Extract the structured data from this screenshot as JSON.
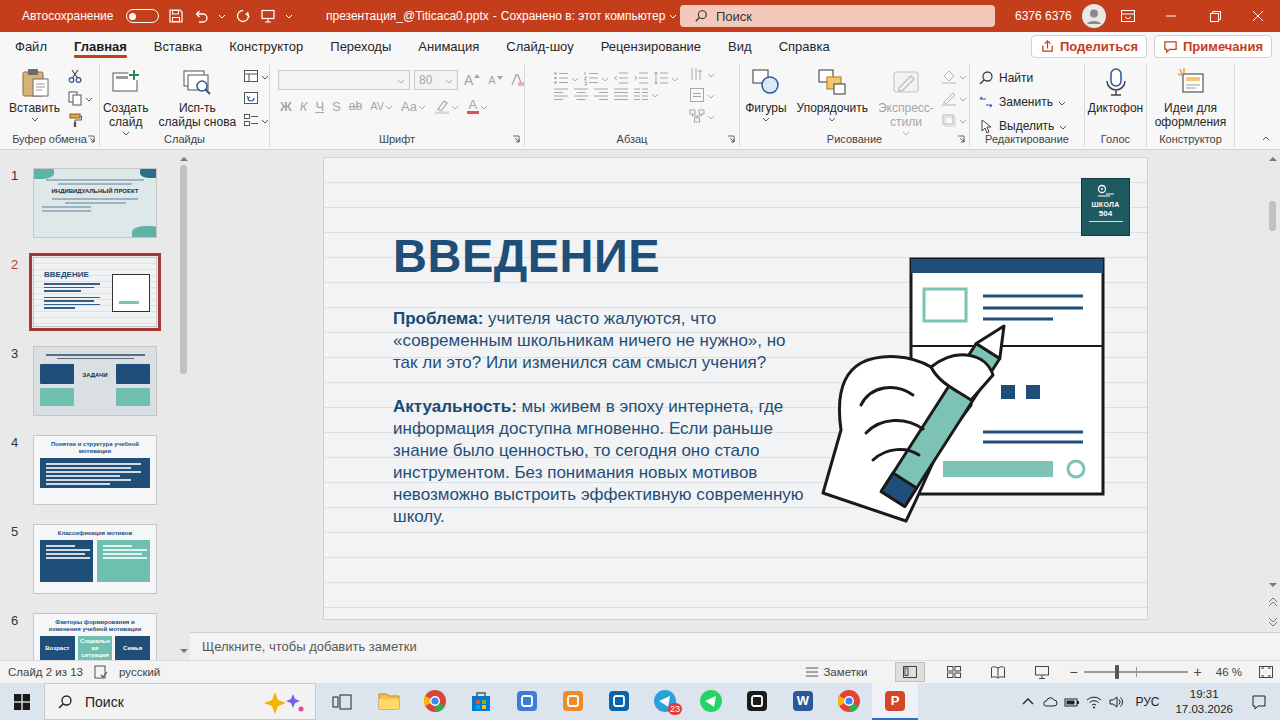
{
  "titlebar": {
    "autosave_label": "Автосохранение",
    "autosave_on": false,
    "filename": "презентация_@Titicaca0.pptx",
    "separator": "-",
    "save_status": "Сохранено в: этот компьютер",
    "search_placeholder": "Поиск",
    "user": "6376 6376"
  },
  "tabs": [
    {
      "label": "Файл",
      "selected": false
    },
    {
      "label": "Главная",
      "selected": true
    },
    {
      "label": "Вставка",
      "selected": false
    },
    {
      "label": "Конструктор",
      "selected": false
    },
    {
      "label": "Переходы",
      "selected": false
    },
    {
      "label": "Анимация",
      "selected": false
    },
    {
      "label": "Слайд-шоу",
      "selected": false
    },
    {
      "label": "Рецензирование",
      "selected": false
    },
    {
      "label": "Вид",
      "selected": false
    },
    {
      "label": "Справка",
      "selected": false
    }
  ],
  "share_button": "Поделиться",
  "comments_button": "Примечания",
  "ribbon": {
    "clipboard": {
      "label": "Буфер обмена",
      "paste": "Вставить"
    },
    "slides": {
      "label": "Слайды",
      "new_slide": [
        "Создать",
        "слайд"
      ],
      "reuse": [
        "Исп-ть",
        "слайды снова"
      ]
    },
    "font": {
      "label": "Шрифт",
      "font_size": "80",
      "disabled": true,
      "size_buttons": [
        "A",
        "A"
      ],
      "format_buttons": [
        "Ж",
        "К",
        "Ч",
        "S",
        "ab",
        "AV",
        "Aa"
      ],
      "font_color": "A"
    },
    "paragraph": {
      "label": "Абзац",
      "disabled": true
    },
    "drawing": {
      "label": "Рисование",
      "buttons": [
        {
          "lines": [
            "Фигуры"
          ],
          "disabled": false
        },
        {
          "lines": [
            "Упорядочить"
          ],
          "disabled": false
        },
        {
          "lines": [
            "Экспресс-",
            "стили"
          ],
          "disabled": true
        }
      ]
    },
    "editing": {
      "label": "Редактирование",
      "buttons": [
        {
          "label": "Найти",
          "caret": false
        },
        {
          "label": "Заменить",
          "caret": true
        },
        {
          "label": "Выделить",
          "caret": true
        }
      ]
    },
    "voice": {
      "label": "Голос",
      "dictate": "Диктофон"
    },
    "designer": {
      "label": "Конструктор",
      "ideas": [
        "Идеи для",
        "оформления"
      ]
    }
  },
  "thumbnails": [
    {
      "number": "1",
      "selected": false,
      "kind": "cover",
      "title": "ИНДИВИДУАЛЬНЫЙ ПРОЕКТ",
      "items": []
    },
    {
      "number": "2",
      "selected": true,
      "kind": "intro",
      "title": "ВВЕДЕНИЕ",
      "items": []
    },
    {
      "number": "3",
      "selected": false,
      "kind": "tasks",
      "title": "ЗАДАЧИ",
      "items": []
    },
    {
      "number": "4",
      "selected": false,
      "kind": "text",
      "title": "Понятие и структура учебной мотивации",
      "items": []
    },
    {
      "number": "5",
      "selected": false,
      "kind": "columns",
      "title": "Классификация мотивов",
      "items": []
    },
    {
      "number": "6",
      "selected": false,
      "kind": "factors",
      "title": "Факторы формирования и изменения учебной мотивации",
      "items": [
        "Возраст",
        "Социальная ситуация",
        "Семья"
      ]
    }
  ],
  "slide": {
    "title": "ВВЕДЕНИЕ",
    "paragraphs": [
      {
        "label": "Проблема:",
        "text": "учителя часто жалуются, что «современным школьникам ничего не нужно», но так ли это? Или изменился сам смысл учения?"
      },
      {
        "label": "Актуальность:",
        "text": "мы живем в эпоху интернета, где информация доступна мгновенно. Если раньше знание было ценностью, то сегодня оно стало инструментом. Без понимания новых мотивов невозможно выстроить эффективную современную школу."
      }
    ],
    "logo": {
      "line1": "ШКОЛА",
      "line2": "504"
    }
  },
  "notes_placeholder": "Щелкните, чтобы добавить заметки",
  "status_bar": {
    "slide_counter": "Слайд 2 из 13",
    "language": "русский",
    "notes_button": "Заметки",
    "views": [
      {
        "kind": "normal",
        "selected": true
      },
      {
        "kind": "sorter",
        "selected": false
      },
      {
        "kind": "reading",
        "selected": false
      },
      {
        "kind": "slideshow",
        "selected": false
      }
    ],
    "zoom_minus": "−",
    "zoom_plus": "+",
    "zoom_level": 0.32,
    "zoom": "46 %"
  },
  "taskbar": {
    "search_placeholder": "Поиск",
    "apps": [
      {
        "kind": "folder",
        "color": "#f2c14e",
        "selected": false
      },
      {
        "kind": "chrome",
        "color": "#db4437",
        "selected": false
      },
      {
        "kind": "bag",
        "color": "#0078d4",
        "selected": false
      },
      {
        "kind": "square",
        "color": "#3b7dd8",
        "selected": false
      },
      {
        "kind": "square",
        "color": "#f08a24",
        "selected": false
      },
      {
        "kind": "square",
        "color": "#0a64ad",
        "selected": false
      },
      {
        "kind": "circle",
        "color": "#2aa1da",
        "selected": false,
        "badge": "23"
      },
      {
        "kind": "circle",
        "color": "#25d366",
        "selected": false
      },
      {
        "kind": "square",
        "color": "#1a1a1a",
        "selected": false
      },
      {
        "kind": "square",
        "color": "#2b579a",
        "selected": false,
        "glyph": "W"
      },
      {
        "kind": "chrome",
        "color": "#e94235",
        "selected": false
      },
      {
        "kind": "square",
        "color": "#d24726",
        "selected": true,
        "glyph": "P"
      }
    ],
    "language": "РУС",
    "time": "19:31",
    "date": "17.03.2026"
  }
}
